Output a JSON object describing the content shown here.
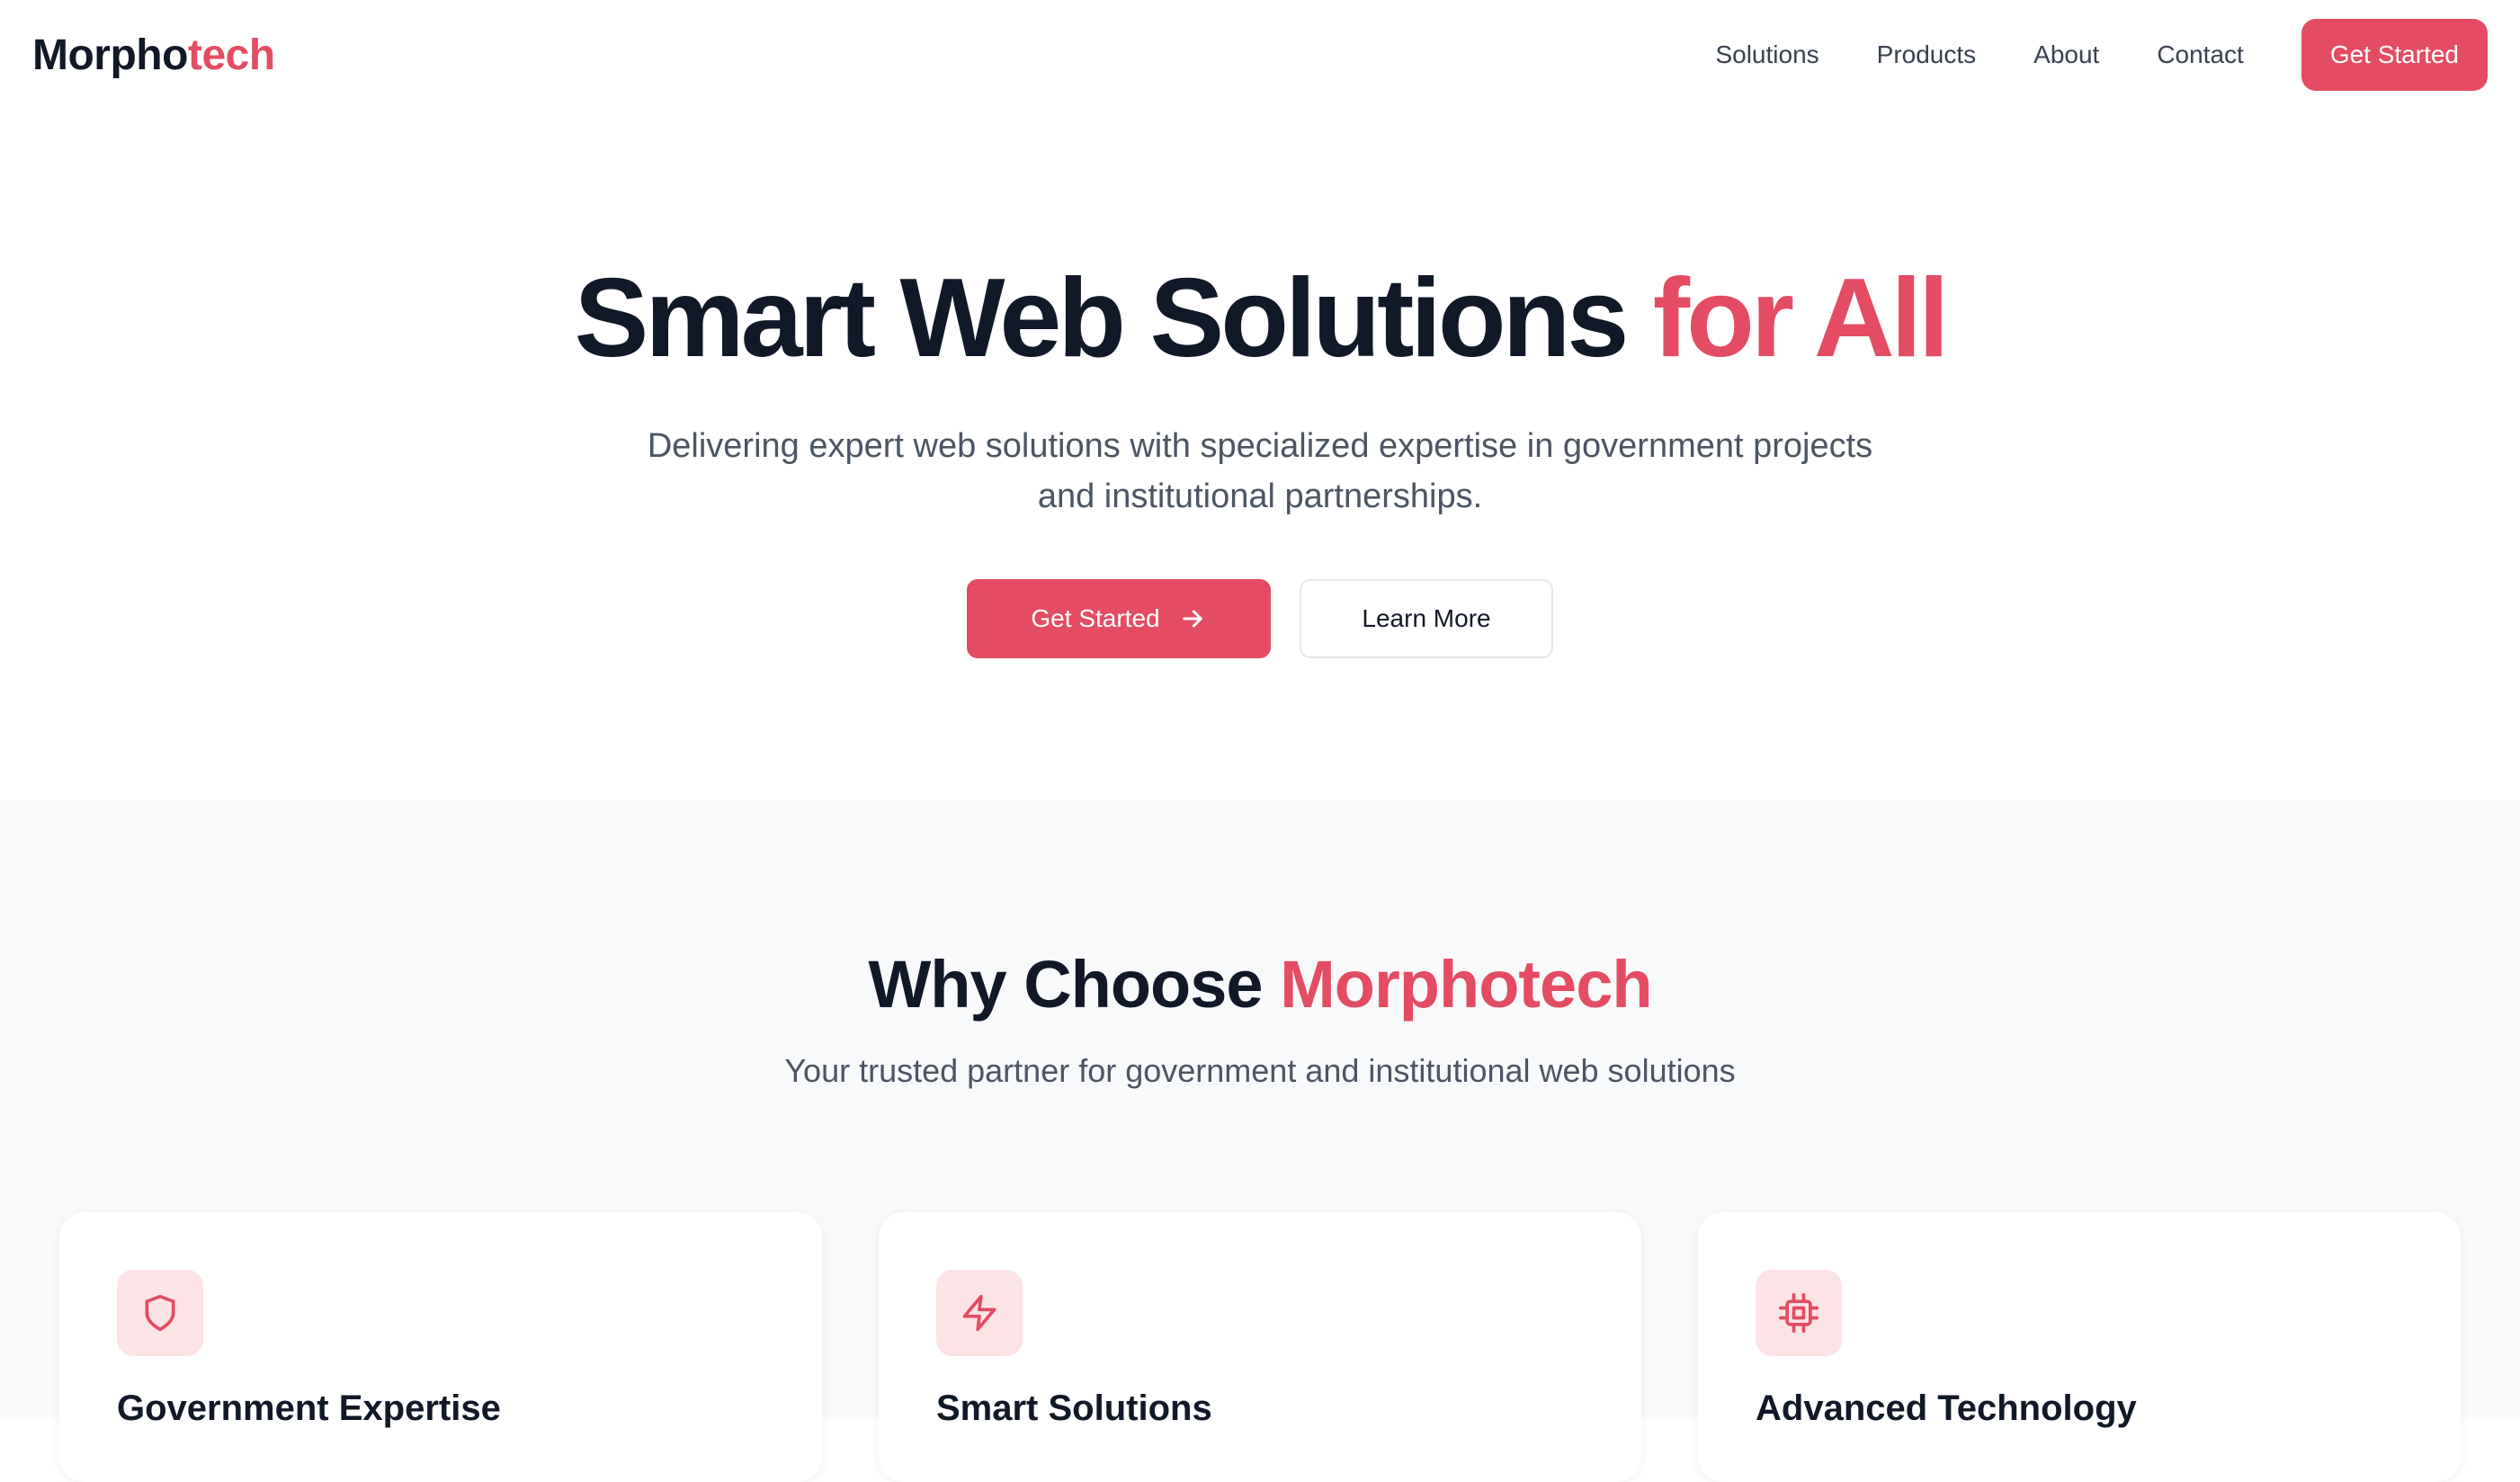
{
  "colors": {
    "accent": "#e34c63",
    "text_dark": "#111827",
    "text_muted": "#4b5563",
    "section_bg": "#f8f9fb",
    "icon_bg": "#fce3e6"
  },
  "nav": {
    "logo_part1": "Morpho",
    "logo_part2": "tech",
    "links": [
      "Solutions",
      "Products",
      "About",
      "Contact"
    ],
    "cta_label": "Get Started"
  },
  "hero": {
    "title_part1": "Smart Web Solutions ",
    "title_part2": "for All",
    "subtitle": "Delivering expert web solutions with specialized expertise in government projects and institutional partnerships.",
    "primary_button": "Get Started",
    "primary_icon": "arrow-right-icon",
    "secondary_button": "Learn More"
  },
  "why": {
    "title_part1": "Why Choose ",
    "title_part2": "Morphotech",
    "subtitle": "Your trusted partner for government and institutional web solutions",
    "cards": [
      {
        "title": "Government Expertise",
        "icon": "shield-icon"
      },
      {
        "title": "Smart Solutions",
        "icon": "lightning-icon"
      },
      {
        "title": "Advanced Technology",
        "icon": "cpu-chip-icon"
      }
    ]
  }
}
